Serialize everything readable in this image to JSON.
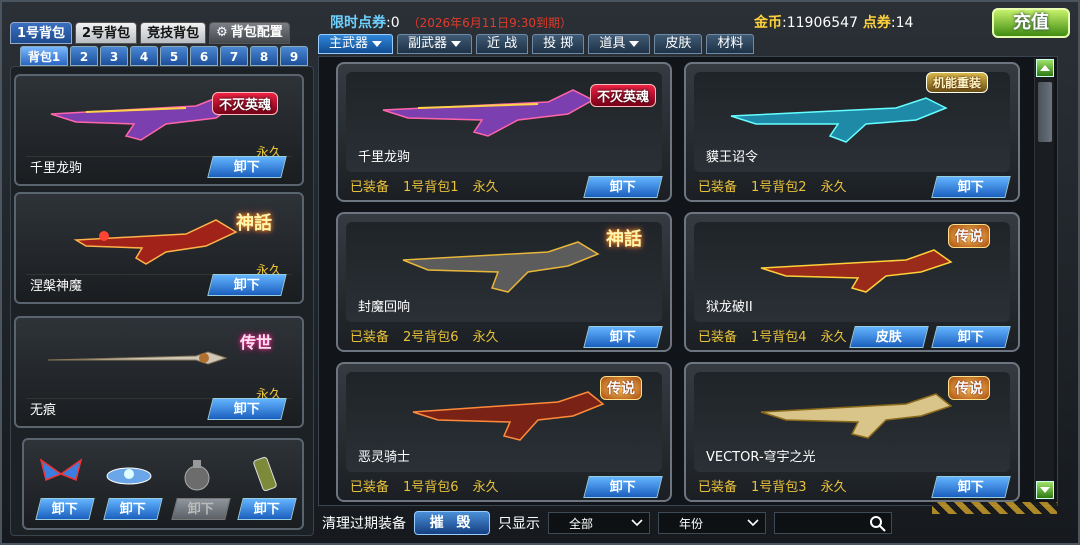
{
  "bag_tabs": [
    {
      "label": "1号背包",
      "active": true
    },
    {
      "label": "2号背包",
      "active": false
    },
    {
      "label": "竞技背包",
      "active": false
    }
  ],
  "bag_config_label": "背包配置",
  "subtabs": [
    "背包1",
    "2",
    "3",
    "4",
    "5",
    "6",
    "7",
    "8",
    "9"
  ],
  "header": {
    "limited_label": "限时点券",
    "limited_value": ":0",
    "limited_date": "（2026年6月11日9:30到期）",
    "gold_label": "金币",
    "gold_value": ":11906547",
    "points_label": "点券",
    "points_value": ":14",
    "recharge": "充值"
  },
  "category_tabs": [
    "主武器",
    "副武器",
    "近 战",
    "投 掷",
    "道具",
    "皮肤",
    "材料"
  ],
  "left_cards": [
    {
      "name": "千里龙驹",
      "duration": "永久",
      "action": "卸下",
      "badge": "不灭英魂"
    },
    {
      "name": "涅槃神魔",
      "duration": "永久",
      "action": "卸下",
      "badge": "神話"
    },
    {
      "name": "无痕",
      "duration": "永久",
      "action": "卸下",
      "badge": "传世"
    }
  ],
  "small_items": [
    {
      "action": "卸下",
      "enabled": true
    },
    {
      "action": "卸下",
      "enabled": true
    },
    {
      "action": "卸下",
      "enabled": false
    },
    {
      "action": "卸下",
      "enabled": true
    }
  ],
  "grid_cards": [
    {
      "name": "千里龙驹",
      "status": "已装备",
      "bag": "1号背包1",
      "duration": "永久",
      "action": "卸下",
      "badge": "不灭英魂"
    },
    {
      "name": "貘王诏令",
      "status": "已装备",
      "bag": "1号背包2",
      "duration": "永久",
      "action": "卸下",
      "badge": "机能重装"
    },
    {
      "name": "封魔回响",
      "status": "已装备",
      "bag": "2号背包6",
      "duration": "永久",
      "action": "卸下",
      "badge": "神話"
    },
    {
      "name": "狱龙破II",
      "status": "已装备",
      "bag": "1号背包4",
      "duration": "永久",
      "action": "卸下",
      "skin": "皮肤",
      "badge": "传说"
    },
    {
      "name": "恶灵骑士",
      "status": "已装备",
      "bag": "1号背包6",
      "duration": "永久",
      "action": "卸下",
      "badge": "传说"
    },
    {
      "name": "VECTOR-穹宇之光",
      "status": "已装备",
      "bag": "1号背包3",
      "duration": "永久",
      "action": "卸下",
      "badge": "传说"
    }
  ],
  "bottom": {
    "clear_label": "清理过期装备",
    "destroy": "摧 毁",
    "filter_label": "只显示",
    "filter_all": "全部",
    "filter_year": "年份"
  },
  "colors": {
    "gold_text": "#e8c23a",
    "accent_blue": "#2f86d8",
    "recharge_green": "#3f8c12"
  }
}
